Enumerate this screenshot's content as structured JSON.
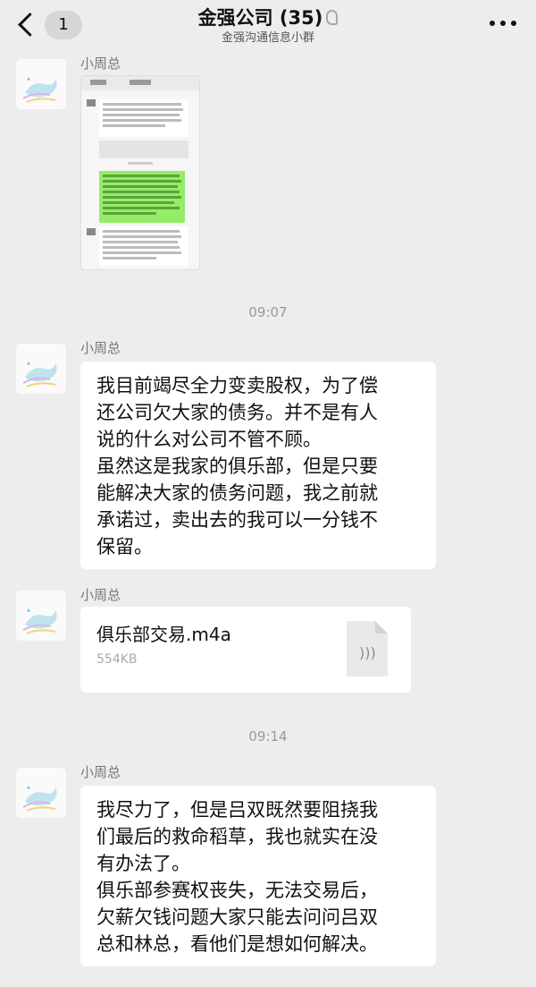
{
  "header": {
    "back_count": "1",
    "title": "金强公司 (35)",
    "subtitle": "金强沟通信息小群"
  },
  "messages": [
    {
      "type": "image",
      "sender": "小周总"
    },
    {
      "type": "time",
      "text": "09:07"
    },
    {
      "type": "text",
      "sender": "小周总",
      "text": "我目前竭尽全力变卖股权，为了偿\n还公司欠大家的债务。并不是有人\n说的什么对公司不管不顾。\n虽然这是我家的俱乐部，但是只要\n能解决大家的债务问题，我之前就\n承诺过，卖出去的我可以一分钱不\n保留。"
    },
    {
      "type": "file",
      "sender": "小周总",
      "file_name": "俱乐部交易.m4a",
      "file_size": "554KB"
    },
    {
      "type": "time",
      "text": "09:14"
    },
    {
      "type": "text",
      "sender": "小周总",
      "text": "我尽力了，但是吕双既然要阻挠我\n们最后的救命稻草，我也就实在没\n有办法了。\n俱乐部参赛权丧失，无法交易后，\n欠薪欠钱问题大家只能去问问吕双\n总和林总，看他们是想如何解决。"
    }
  ],
  "colors": {
    "background": "#ededed",
    "bubble": "#ffffff",
    "green_bubble": "#95ec69"
  }
}
